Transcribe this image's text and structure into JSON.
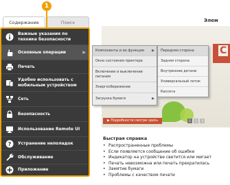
{
  "callout": "1",
  "tabs": [
    {
      "label": "Содержание",
      "active": true
    },
    {
      "label": "Поиск",
      "active": false
    }
  ],
  "page_title": "Элем",
  "sidebar": {
    "items": [
      {
        "label": "Важные указания по технике безопасности",
        "icon": "info-icon"
      },
      {
        "label": "Основные операции",
        "icon": "hand-icon"
      },
      {
        "label": "Печать",
        "icon": "printer-icon"
      },
      {
        "label": "Удобно использовать с мобильным устройством",
        "icon": "mobile-icon"
      },
      {
        "label": "Сеть",
        "icon": "network-icon"
      },
      {
        "label": "Безопасность",
        "icon": "lock-icon"
      },
      {
        "label": "Использование Remote UI",
        "icon": "monitor-icon"
      },
      {
        "label": "Устранение неполадок",
        "icon": "question-icon"
      },
      {
        "label": "Обслуживание",
        "icon": "wrench-icon"
      },
      {
        "label": "Приложение",
        "icon": "plus-icon"
      }
    ]
  },
  "submenu1": {
    "items": [
      {
        "label": "Компоненты и их функции"
      },
      {
        "label": "Окно состояния принтера"
      },
      {
        "label": "Включение и выключение питания"
      },
      {
        "label": "Энергосбережение"
      },
      {
        "label": "Загрузка бумаги"
      }
    ]
  },
  "submenu2": {
    "items": [
      {
        "label": "Передняя сторона"
      },
      {
        "label": "Задняя сторона"
      },
      {
        "label": "Внутренние детали"
      },
      {
        "label": "Универсальный лоток"
      },
      {
        "label": "Кассета"
      }
    ]
  },
  "banner": {
    "letter": "C",
    "link": "▶ Подробности смотри здесь",
    "pages": [
      "1",
      "2",
      "3"
    ]
  },
  "quick_help": {
    "title": "Быстрая справка",
    "items": [
      "Распространенные проблемы",
      "Если появляется сообщение об ошибке",
      "Индикатор на устройстве светится или мигает",
      "Печать невозможна или печать прекратилась",
      "Замятие бумаги",
      "Проблемы с качеством печати"
    ]
  },
  "colors": {
    "accent": "#f0a000",
    "sidebar_bg": "#3a3a3a",
    "banner_red": "#c85038"
  }
}
